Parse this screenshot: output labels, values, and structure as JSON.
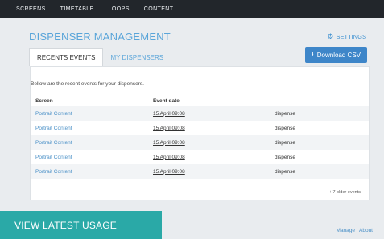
{
  "nav": {
    "items": [
      "SCREENS",
      "TIMETABLE",
      "LOOPS",
      "CONTENT"
    ]
  },
  "header": {
    "title": "DISPENSER MANAGEMENT",
    "settings_label": "SETTINGS"
  },
  "tabs": [
    {
      "label": "RECENTS EVENTS",
      "active": true
    },
    {
      "label": "MY DISPENSERS",
      "active": false
    }
  ],
  "toolbar": {
    "download_label": "Download CSV"
  },
  "events": {
    "intro": "Bellow are the recent events for your dispensers.",
    "columns": [
      "Screen",
      "Event date",
      ""
    ],
    "rows": [
      {
        "screen": "Portrait Content",
        "date": "15 April 09:08",
        "action": "dispense"
      },
      {
        "screen": "Portrait Content",
        "date": "15 April 09:08",
        "action": "dispense"
      },
      {
        "screen": "Portrait Content",
        "date": "15 April 09:08",
        "action": "dispense"
      },
      {
        "screen": "Portrait Content",
        "date": "15 April 09:08",
        "action": "dispense"
      },
      {
        "screen": "Portrait Content",
        "date": "15 April 09:08",
        "action": "dispense"
      }
    ],
    "older_label": "+ 7 older events"
  },
  "overlay": {
    "label": "VIEW LATEST USAGE"
  },
  "footer": {
    "manage_label": "Manage",
    "separator": "|",
    "about_label": "About"
  },
  "colors": {
    "nav_bg": "#22262b",
    "accent": "#5aa5d9",
    "button": "#3e86c9",
    "overlay": "#2aa9a7"
  }
}
